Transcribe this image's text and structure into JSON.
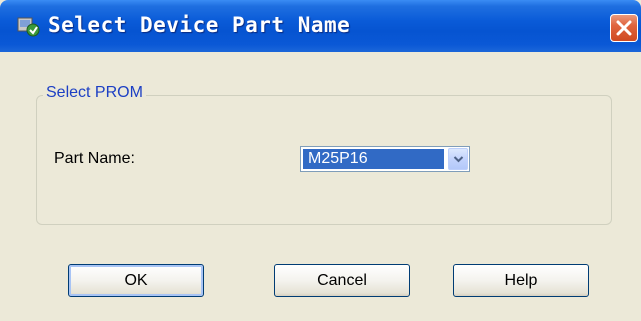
{
  "window": {
    "title": "Select Device Part Name"
  },
  "group": {
    "legend": "Select PROM"
  },
  "part_name": {
    "label": "Part Name:",
    "selected_value": "M25P16"
  },
  "buttons": {
    "ok_label": "OK",
    "cancel_label": "Cancel",
    "help_label": "Help"
  },
  "colors": {
    "titlebar": "#0654d1",
    "close_button": "#e0643e",
    "selection": "#316ac5",
    "legend_text": "#1c3fc4",
    "dialog_bg": "#ece9d8"
  },
  "icons": {
    "app": "impact-app-icon",
    "close": "close-icon",
    "dropdown": "chevron-down-icon"
  }
}
